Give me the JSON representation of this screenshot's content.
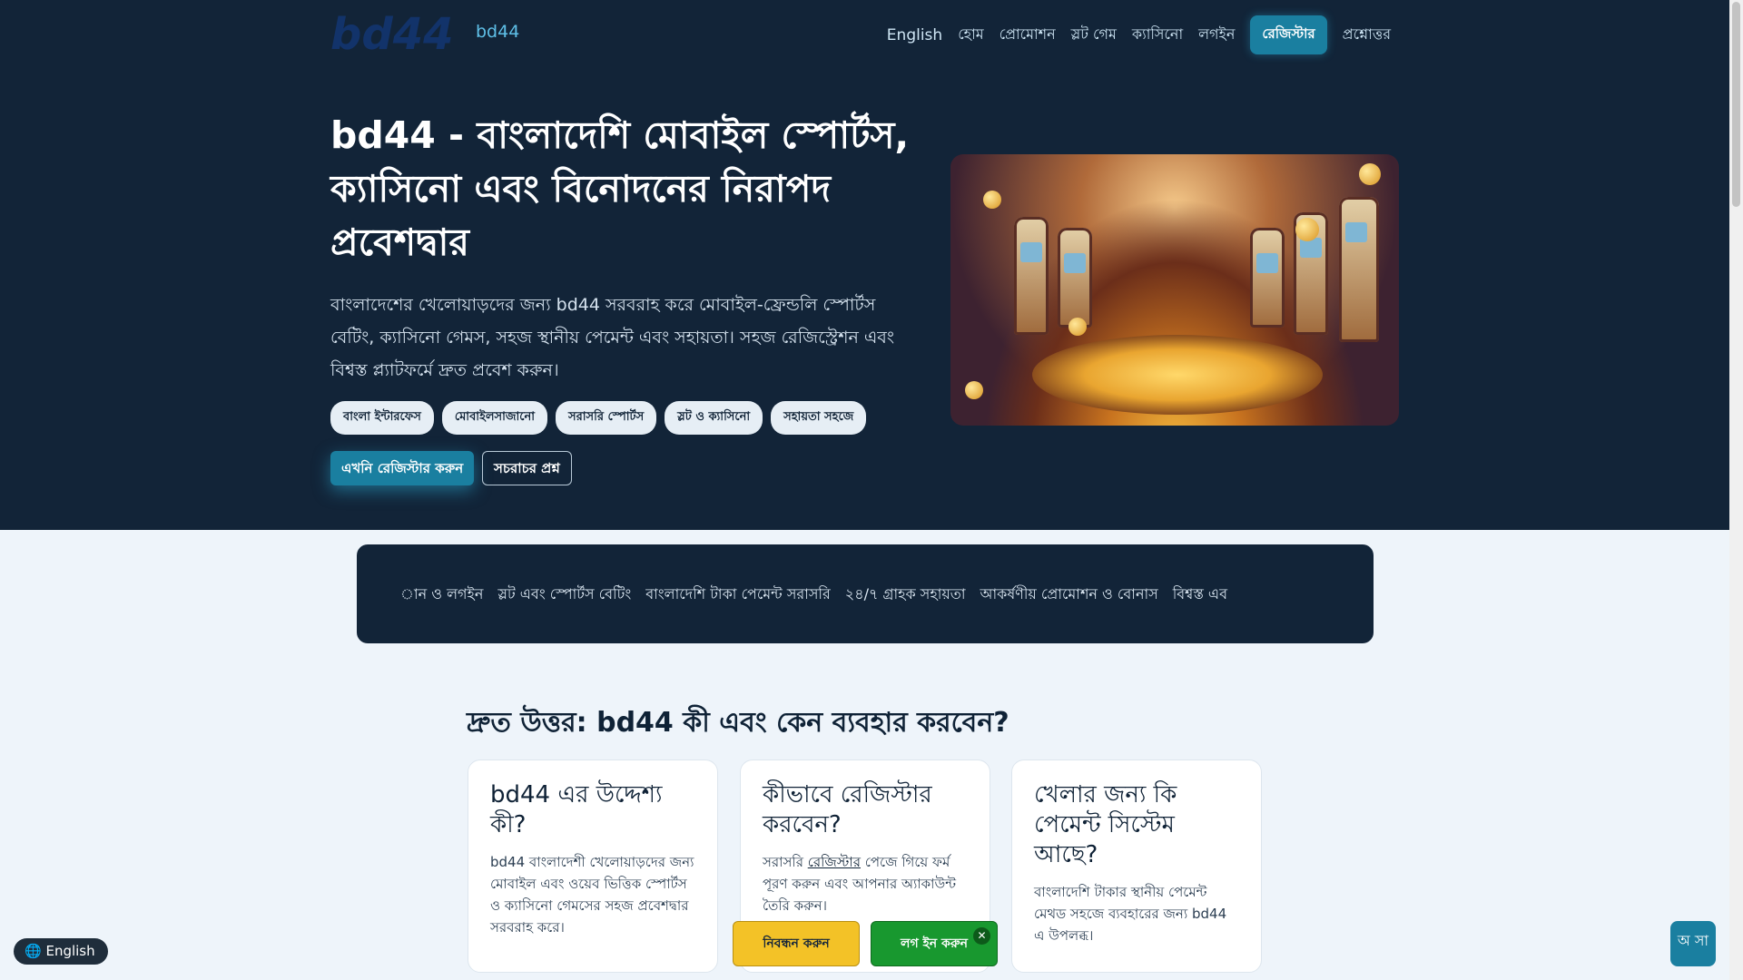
{
  "header": {
    "logo_wordmark": "bd44",
    "brand": "bd44",
    "nav": [
      "English",
      "হোম",
      "প্রোমোশন",
      "স্লট গেম",
      "ক্যাসিনো",
      "লগইন"
    ],
    "register": "রেজিস্টার",
    "faq": "প্রশ্নোত্তর"
  },
  "hero": {
    "title": "bd44 - বাংলাদেশি মোবাইল স্পোর্টস, ক্যাসিনো এবং বিনোদনের নিরাপদ প্রবেশদ্বার",
    "lead": "বাংলাদেশের খেলোয়াড়দের জন্য bd44 সরবরাহ করে মোবাইল-ফ্রেন্ডলি স্পোর্টস বেটিং, ক্যাসিনো গেমস, সহজ স্থানীয় পেমেন্ট এবং সহায়তা। সহজ রেজিস্ট্রেশন এবং বিশ্বস্ত প্ল্যাটফর্মে দ্রুত প্রবেশ করুন।",
    "chips": [
      "বাংলা ইন্টারফেস",
      "মোবাইলসাজানো",
      "সরাসরি স্পোর্টস",
      "স্লট ও ক্যাসিনো",
      "সহায়তা সহজে"
    ],
    "cta_primary": "এখনি রেজিস্টার করুন",
    "cta_secondary": "সচরাচর প্রশ্ন"
  },
  "marquee": {
    "items": [
      "ান ও লগইন",
      "স্লট এবং স্পোর্টস বেটিং",
      "বাংলাদেশি টাকা পেমেন্ট সরাসরি",
      "২৪/৭ গ্রাহক সহায়তা",
      "আকর্ষণীয় প্রোমোশন ও বোনাস",
      "বিশ্বস্ত এব"
    ]
  },
  "faq": {
    "title": "দ্রুত উত্তর: bd44 কী এবং কেন ব্যবহার করবেন?",
    "cards": [
      {
        "title": "bd44 এর উদ্দেশ্য কী?",
        "text": "bd44 বাংলাদেশী খেলোয়াড়দের জন্য মোবাইল এবং ওয়েব ভিত্তিক স্পোর্টস ও ক্যাসিনো গেমসের সহজ প্রবেশদ্বার সরবরাহ করে।"
      },
      {
        "title": "কীভাবে রেজিস্টার করবেন?",
        "text_before": "সরাসরি ",
        "link": "রেজিস্টার",
        "text_after": " পেজে গিয়ে ফর্ম পূরণ করুন এবং আপনার অ্যাকাউন্ট তৈরি করুন।"
      },
      {
        "title": "খেলার জন্য কি পেমেন্ট সিস্টেম আছে?",
        "text": "বাংলাদেশি টাকার স্থানীয় পেমেন্ট মেথড সহজে ব্যবহারের জন্য bd44 এ উপলব্ধ।"
      }
    ]
  },
  "floating": {
    "language": "English",
    "signup": "নিবন্ধন করুন",
    "login": "লগ ইন করুন",
    "close": "✕",
    "chat": "অ সা"
  },
  "colors": {
    "hero_bg": "#122438",
    "accent": "#1a7fa0",
    "signup_yellow": "#f3c227",
    "login_green": "#18982f"
  }
}
